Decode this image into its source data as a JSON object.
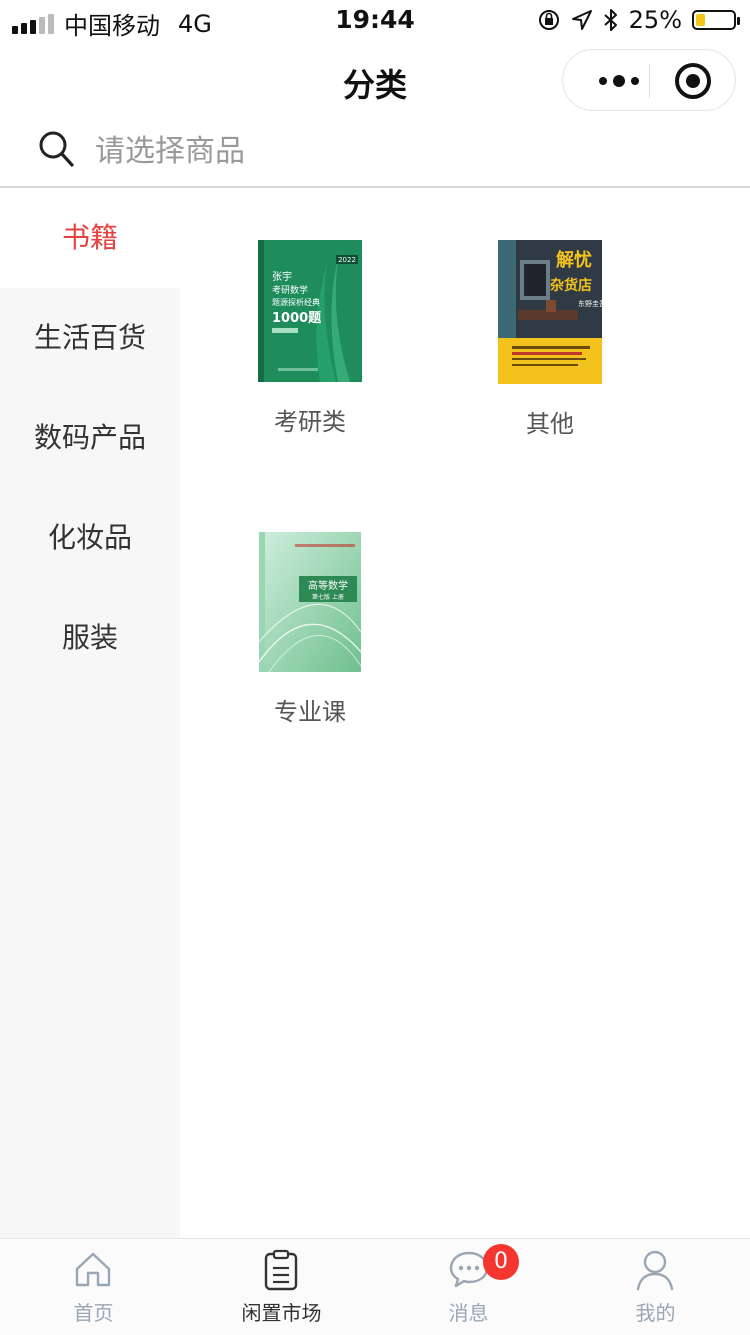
{
  "status_bar": {
    "carrier": "中国移动",
    "network": "4G",
    "time": "19:44",
    "battery": "25%",
    "battery_level": 0.25
  },
  "nav": {
    "title": "分类"
  },
  "search": {
    "placeholder": "请选择商品",
    "value": ""
  },
  "sidebar": {
    "items": [
      {
        "label": "书籍",
        "active": true
      },
      {
        "label": "生活百货",
        "active": false
      },
      {
        "label": "数码产品",
        "active": false
      },
      {
        "label": "化妆品",
        "active": false
      },
      {
        "label": "服装",
        "active": false
      }
    ]
  },
  "categories": [
    {
      "label": "考研类",
      "cover_text": [
        "张宇",
        "考研数学",
        "题源探析经典",
        "1000题"
      ],
      "cover_badge": "2022"
    },
    {
      "label": "其他",
      "cover_text": [
        "解忧",
        "杂货店",
        "东野圭吾"
      ]
    },
    {
      "label": "专业课",
      "cover_text": [
        "高等数学",
        "第七版 上册"
      ]
    }
  ],
  "tabbar": {
    "items": [
      {
        "label": "首页",
        "icon": "home-icon",
        "active": false
      },
      {
        "label": "闲置市场",
        "icon": "clipboard-icon",
        "active": true
      },
      {
        "label": "消息",
        "icon": "chat-icon",
        "active": false,
        "badge": "0"
      },
      {
        "label": "我的",
        "icon": "user-icon",
        "active": false
      }
    ]
  },
  "colors": {
    "accent_red": "#e64340",
    "badge_red": "#f43530",
    "sidebar_bg": "#f7f7f7",
    "tab_inactive": "#9aa6b4"
  }
}
